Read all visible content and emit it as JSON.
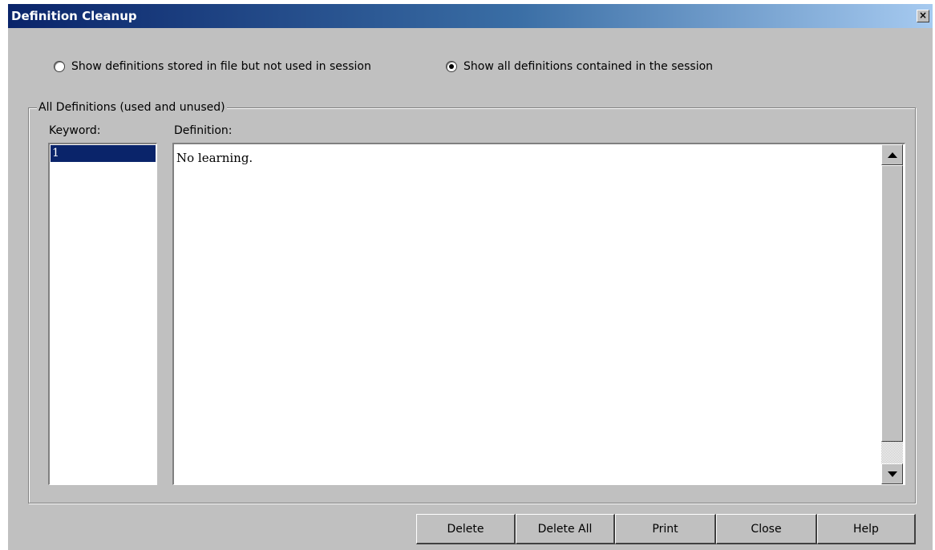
{
  "window": {
    "title": "Definition Cleanup",
    "close_glyph": "×"
  },
  "options": {
    "unused": {
      "label": "Show definitions stored in file but not used in session",
      "selected": false
    },
    "all": {
      "label": "Show all definitions contained in the session",
      "selected": true
    }
  },
  "group": {
    "label": "All Definitions (used and unused)",
    "keyword_header": "Keyword:",
    "definition_header": "Definition:"
  },
  "keywords": {
    "items": [
      "1"
    ],
    "selected_index": 0
  },
  "definition": {
    "text": "No learning."
  },
  "buttons": {
    "delete": "Delete",
    "delete_all": "Delete All",
    "print": "Print",
    "close": "Close",
    "help": "Help"
  },
  "colors": {
    "title_gradient_start": "#0a246a",
    "title_gradient_end": "#a6caf0",
    "face": "#c0c0c0",
    "selection": "#0a246a"
  }
}
